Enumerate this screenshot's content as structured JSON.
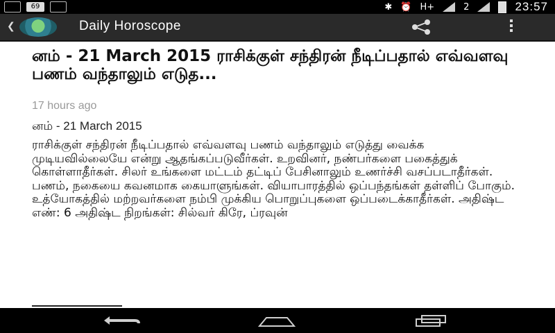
{
  "status_bar": {
    "notification_count": "69",
    "network_label": "H+",
    "sim2_label": "2",
    "time": "23:57",
    "icons": [
      "image-icon",
      "sim-badge-icon",
      "download-icon",
      "bluetooth-icon",
      "alarm-icon",
      "signal-icon",
      "signal-2-icon",
      "battery-icon"
    ]
  },
  "action_bar": {
    "title": "Daily Horoscope",
    "icons": [
      "back-chevron-icon",
      "app-logo-icon",
      "share-icon",
      "overflow-menu-icon"
    ]
  },
  "article": {
    "headline": "னம் - 21 March 2015 ராசிக்குள் சந்திரன் நீடிப்பதால் எவ்வளவு பணம் வந்தாலும் எடுத...",
    "time_ago": "17 hours ago",
    "date_line": "னம் - 21 March 2015",
    "body": "ராசிக்குள் சந்திரன் நீடிப்பதால் எவ்வளவு பணம் வந்தாலும் எடுத்து வைக்க முடியவில்லையே என்று ஆதங்கப்படுவீர்கள். உறவினர், நண்பர்களை பகைத்துக் கொள்ளாதீர்கள். சிலர் உங்களை மட்டம் தட்டிப் பேசினாலும் உணர்ச்சி வசப்படாதீர்கள். பணம், நகையை கவனமாக கையாளுங்கள். வியாபாரத்தில் ஒப்பந்தங்கள் தள்ளிப் போகும். உத்யோகத்தில் மற்றவர்களை நம்பி முக்கிய பொறுப்புகளை ஒப்படைக்காதீர்கள். அதிஷ்ட எண்: 6 அதிஷ்ட நிறங்கள்: சில்வர் கிரே, ப்ரவுன்"
  },
  "nav_bar": {
    "icons": [
      "back-icon",
      "home-icon",
      "recent-apps-icon"
    ]
  }
}
